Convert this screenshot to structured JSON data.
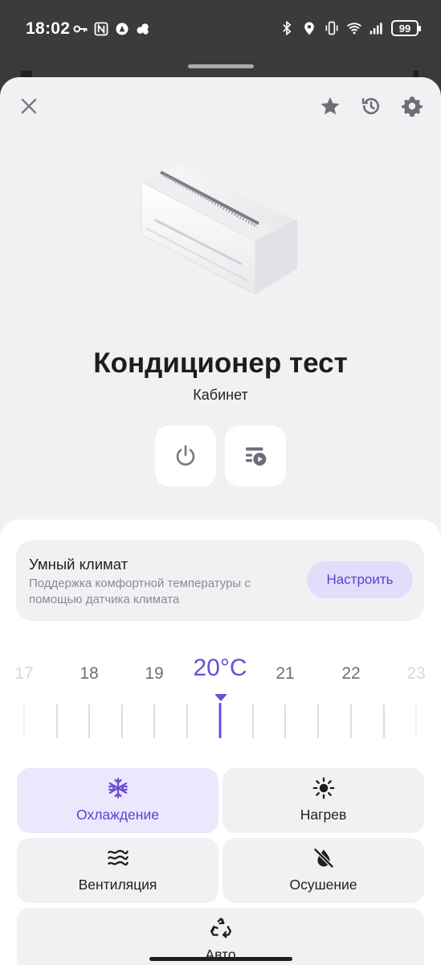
{
  "status_bar": {
    "time": "18:02",
    "battery": "99",
    "left_icons": [
      "key-icon",
      "nfc-icon",
      "alice-icon",
      "cloud-icon"
    ],
    "right_icons": [
      "bluetooth-icon",
      "location-icon",
      "vibrate-icon",
      "wifi-icon",
      "signal-icon"
    ]
  },
  "header": {
    "actions": [
      "close-icon",
      "star-icon",
      "history-icon",
      "gear-icon"
    ]
  },
  "device": {
    "name": "Кондиционер тест",
    "room": "Кабинет",
    "image": "air-conditioner-icon"
  },
  "quick_actions": [
    "power-icon",
    "scenario-icon"
  ],
  "smart_climate": {
    "title": "Умный климат",
    "description": "Поддержка комфортной температуры с помощью датчика климата",
    "button": "Настроить"
  },
  "temperature": {
    "value": 20,
    "label": "20°C",
    "unit": "°C",
    "visible_values": [
      "17",
      "18",
      "19",
      "21",
      "22",
      "23"
    ]
  },
  "modes": [
    {
      "label": "Охлаждение",
      "icon": "snowflake-icon",
      "selected": true
    },
    {
      "label": "Нагрев",
      "icon": "sun-icon",
      "selected": false
    },
    {
      "label": "Вентиляция",
      "icon": "wind-icon",
      "selected": false
    },
    {
      "label": "Осушение",
      "icon": "drop-off-icon",
      "selected": false
    },
    {
      "label": "Авто",
      "icon": "recycle-icon",
      "selected": false
    }
  ],
  "colors": {
    "accent": "#6a4fd6",
    "accent_light": "#e3dcfb",
    "card_bg": "#f1f1f4"
  }
}
